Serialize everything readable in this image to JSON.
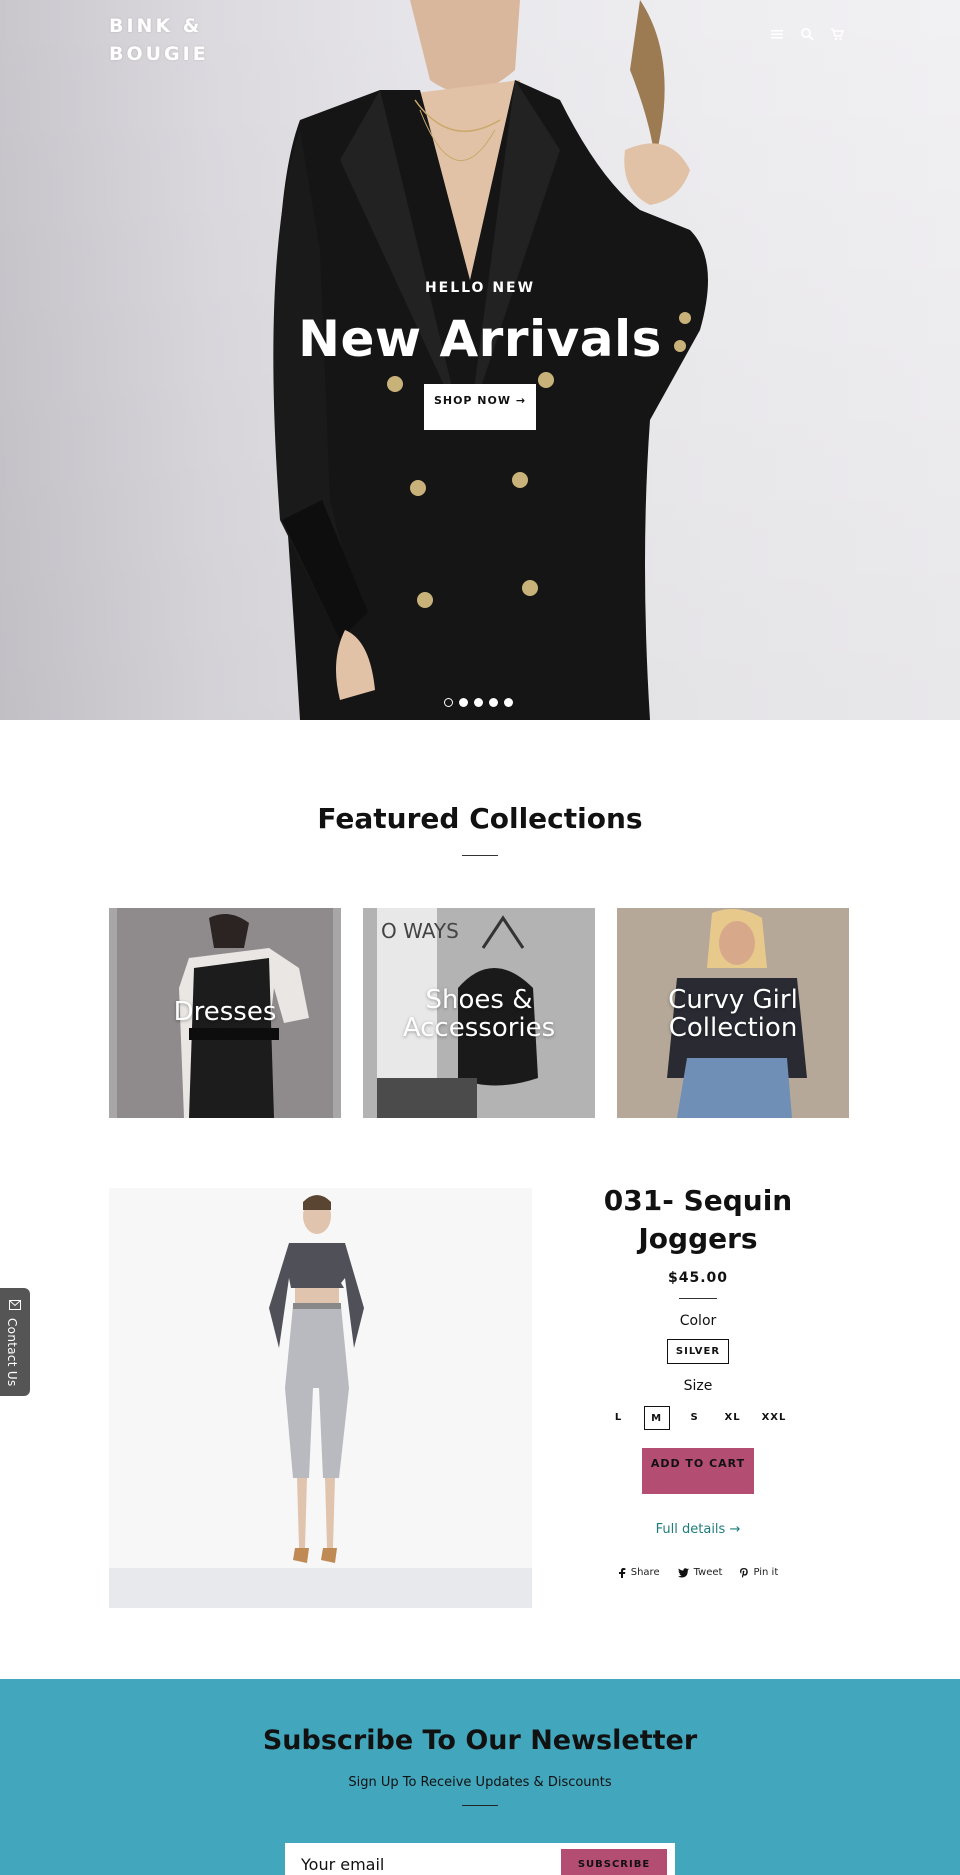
{
  "brand": {
    "logo_text": "BINK & BOUGIE"
  },
  "header": {
    "icons": [
      "menu-icon",
      "search-icon",
      "cart-icon"
    ]
  },
  "hero": {
    "kicker": "HELLO NEW",
    "title": "New Arrivals",
    "cta_label": "SHOP NOW →",
    "slide_count": 5,
    "active_slide": 1
  },
  "featured": {
    "title": "Featured Collections",
    "collections": [
      {
        "label": "Dresses"
      },
      {
        "label": "Shoes & Accessories"
      },
      {
        "label": "Curvy Girl Collection"
      }
    ]
  },
  "product": {
    "title": "031- Sequin Joggers",
    "price": "$45.00",
    "color_label": "Color",
    "color_value": "SILVER",
    "size_label": "Size",
    "sizes": [
      "L",
      "M",
      "S",
      "XL",
      "XXL"
    ],
    "selected_size": "M",
    "add_to_cart": "ADD TO CART",
    "full_details": "Full details →",
    "share": {
      "share": "Share",
      "tweet": "Tweet",
      "pin": "Pin it"
    }
  },
  "contact_tab": {
    "label": "Contact Us"
  },
  "newsletter": {
    "title": "Subscribe To Our Newsletter",
    "subtitle": "Sign Up To Receive Updates & Discounts",
    "email_placeholder": "Your email",
    "button_label": "SUBSCRIBE"
  },
  "colors": {
    "accent_pink": "#b44d72",
    "newsletter_bg": "#42a6bc",
    "link_teal": "#1e7d7a"
  }
}
